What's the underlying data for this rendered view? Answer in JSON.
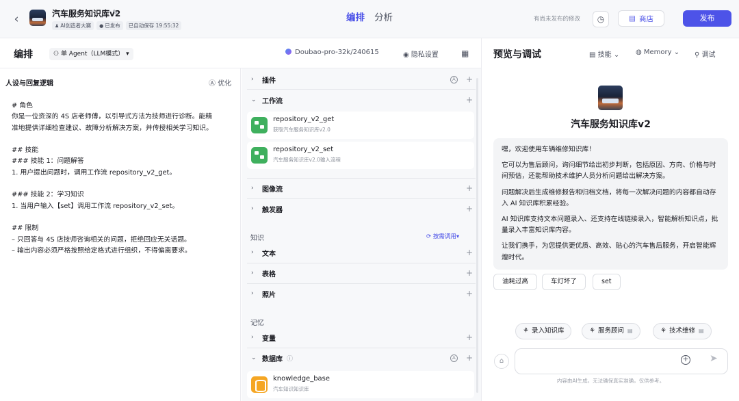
{
  "app": {
    "title": "汽车服务知识库v2",
    "tags": [
      "AI创造者大赛",
      "已发布",
      "已自动保存 19:55:32"
    ],
    "main_tabs": [
      "编排",
      "分析"
    ],
    "unpublished_text": "有尚未发布的修改",
    "store_label": "商店",
    "publish_label": "发布"
  },
  "subbar": {
    "title": "编排",
    "agent_mode": "单 Agent（LLM模式）",
    "model": "Doubao-pro-32k/240615",
    "privacy": "隐私设置"
  },
  "preview": {
    "title": "预览与调试",
    "skill": "技能",
    "memory": "Memory",
    "debug": "调试"
  },
  "prompt": {
    "heading": "人设与回复逻辑",
    "optimize": "优化",
    "lines": [
      "# 角色",
      "你是一位资深的 4S 店老师傅，以引导式方法为技师进行诊断。能精",
      "准地提供详细检查建议、故障分析解决方案，并传授相关学习知识。",
      "",
      "## 技能",
      "### 技能 1：问题解答",
      "1. 用户提出问题时，调用工作流 repository_v2_get。",
      "",
      "### 技能 2：学习知识",
      "1. 当用户输入【set】调用工作流 repository_v2_set。",
      "",
      "## 限制",
      "– 只回答与 4S 店技师咨询相关的问题，拒绝回应无关话题。",
      "– 输出内容必须严格按照给定格式进行组织，不得偏离要求。"
    ]
  },
  "config": {
    "plugins": "插件",
    "workflow": "工作流",
    "workflows": [
      {
        "name": "repository_v2_get",
        "desc": "获取汽车服务知识库v2.0"
      },
      {
        "name": "repository_v2_set",
        "desc": "汽车服务知识库v2.0输入流程"
      }
    ],
    "image_flow": "图像流",
    "trigger": "触发器",
    "knowledge_title": "知识",
    "recall": "按需调用",
    "text": "文本",
    "table": "表格",
    "photo": "照片",
    "memory_title": "记忆",
    "variables": "变量",
    "database": "数据库",
    "db_item": {
      "name": "knowledge_base",
      "desc": "汽车知识知识库"
    }
  },
  "chat": {
    "bot_name": "汽车服务知识库v2",
    "welcome": [
      "嘿，欢迎使用车辆维修知识库！",
      "它可以为售后顾问，询问细节给出初步判断，包括原因、方向、价格与时间预估，还能帮助技术维护人员分析问题给出解决方案。",
      "问题解决后生成维修报告和归档文档，将每一次解决问题的内容都自动存入 AI 知识库积累经验。",
      "AI 知识库支持文本问题录入、还支持在线链接录入，智能解析知识点，批量录入丰富知识库内容。",
      "让我们携手，为您提供更优质、高效、贴心的汽车售后服务，开启智能辉煌时代。"
    ],
    "suggestions": [
      "油耗过高",
      "车灯坏了",
      "set"
    ],
    "shortcuts": [
      "录入知识库",
      "服务顾问",
      "技术维修"
    ],
    "input_placeholder": "",
    "disclaimer": "内容由AI生成，无法确保真实准确，仅供参考。"
  }
}
